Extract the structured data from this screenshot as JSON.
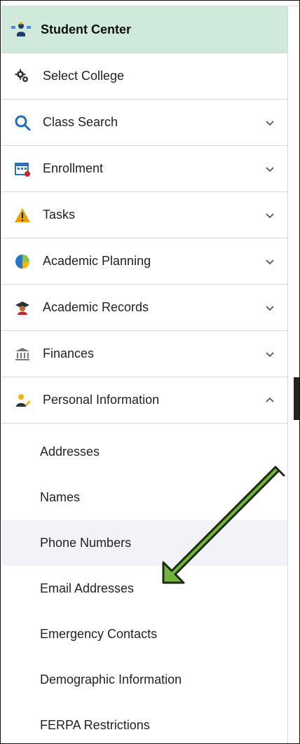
{
  "sidebar": {
    "title": "Student Center",
    "items": [
      {
        "label": "Select College",
        "icon": "gear-icon",
        "expandable": false
      },
      {
        "label": "Class Search",
        "icon": "search-icon",
        "expandable": true
      },
      {
        "label": "Enrollment",
        "icon": "calendar-icon",
        "expandable": true
      },
      {
        "label": "Tasks",
        "icon": "warning-icon",
        "expandable": true
      },
      {
        "label": "Academic Planning",
        "icon": "pie-chart-icon",
        "expandable": true
      },
      {
        "label": "Academic Records",
        "icon": "graduate-icon",
        "expandable": true
      },
      {
        "label": "Finances",
        "icon": "bank-icon",
        "expandable": true
      },
      {
        "label": "Personal Information",
        "icon": "person-edit-icon",
        "expandable": true,
        "expanded": true
      }
    ],
    "personal_information": {
      "submenu": [
        {
          "label": "Addresses"
        },
        {
          "label": "Names"
        },
        {
          "label": "Phone Numbers",
          "active": true
        },
        {
          "label": "Email Addresses"
        },
        {
          "label": "Emergency Contacts"
        },
        {
          "label": "Demographic Information"
        },
        {
          "label": "FERPA Restrictions"
        }
      ]
    }
  },
  "colors": {
    "header_bg": "#cfe9da",
    "active_bg": "#f1f3f8",
    "arrow": "#71b43d",
    "search_icon": "#1c6fbd",
    "warning_icon": "#e6a300",
    "text": "#222222"
  }
}
